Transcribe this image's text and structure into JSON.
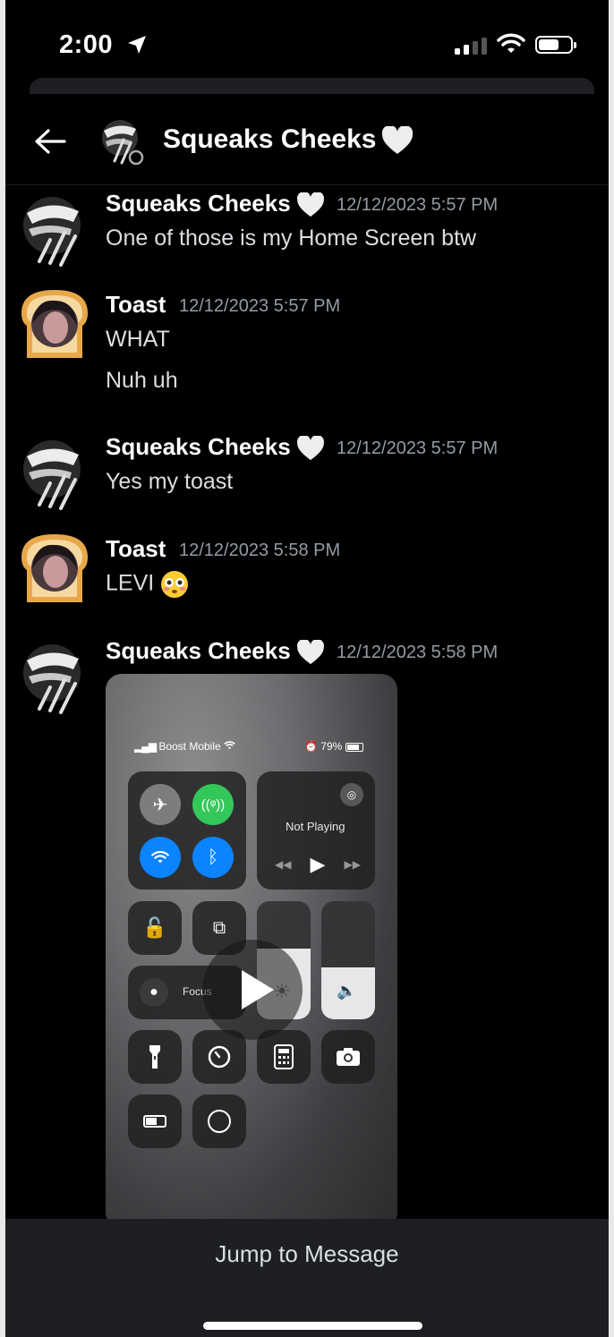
{
  "status_bar": {
    "time": "2:00",
    "battery_level": 0.6
  },
  "header": {
    "back_icon": "arrow-left-icon",
    "title": "Squeaks Cheeks"
  },
  "messages": [
    {
      "author": "Squeaks Cheeks",
      "timestamp": "12/12/2023 5:57 PM",
      "lines": [
        "One of those is my Home Screen btw"
      ]
    },
    {
      "author": "Toast",
      "timestamp": "12/12/2023 5:57 PM",
      "lines": [
        "WHAT",
        "Nuh uh"
      ]
    },
    {
      "author": "Squeaks Cheeks",
      "timestamp": "12/12/2023 5:57 PM",
      "lines": [
        "Yes my toast"
      ]
    },
    {
      "author": "Toast",
      "timestamp": "12/12/2023 5:58 PM",
      "lines": [
        "LEVI"
      ]
    },
    {
      "author": "Squeaks Cheeks",
      "timestamp": "12/12/2023 5:58 PM",
      "lines": []
    }
  ],
  "embed": {
    "carrier": "Boost Mobile",
    "battery": "79%",
    "media_status": "Not Playing",
    "focus_label": "Focus",
    "brightness_level": 0.6,
    "volume_level": 0.44
  },
  "jump_to_message": "Jump to Message",
  "colors": {
    "background": "#000000",
    "bar": "#1e1f22",
    "timestamp": "#949ba4",
    "green": "#34c759",
    "blue": "#0a84ff"
  }
}
